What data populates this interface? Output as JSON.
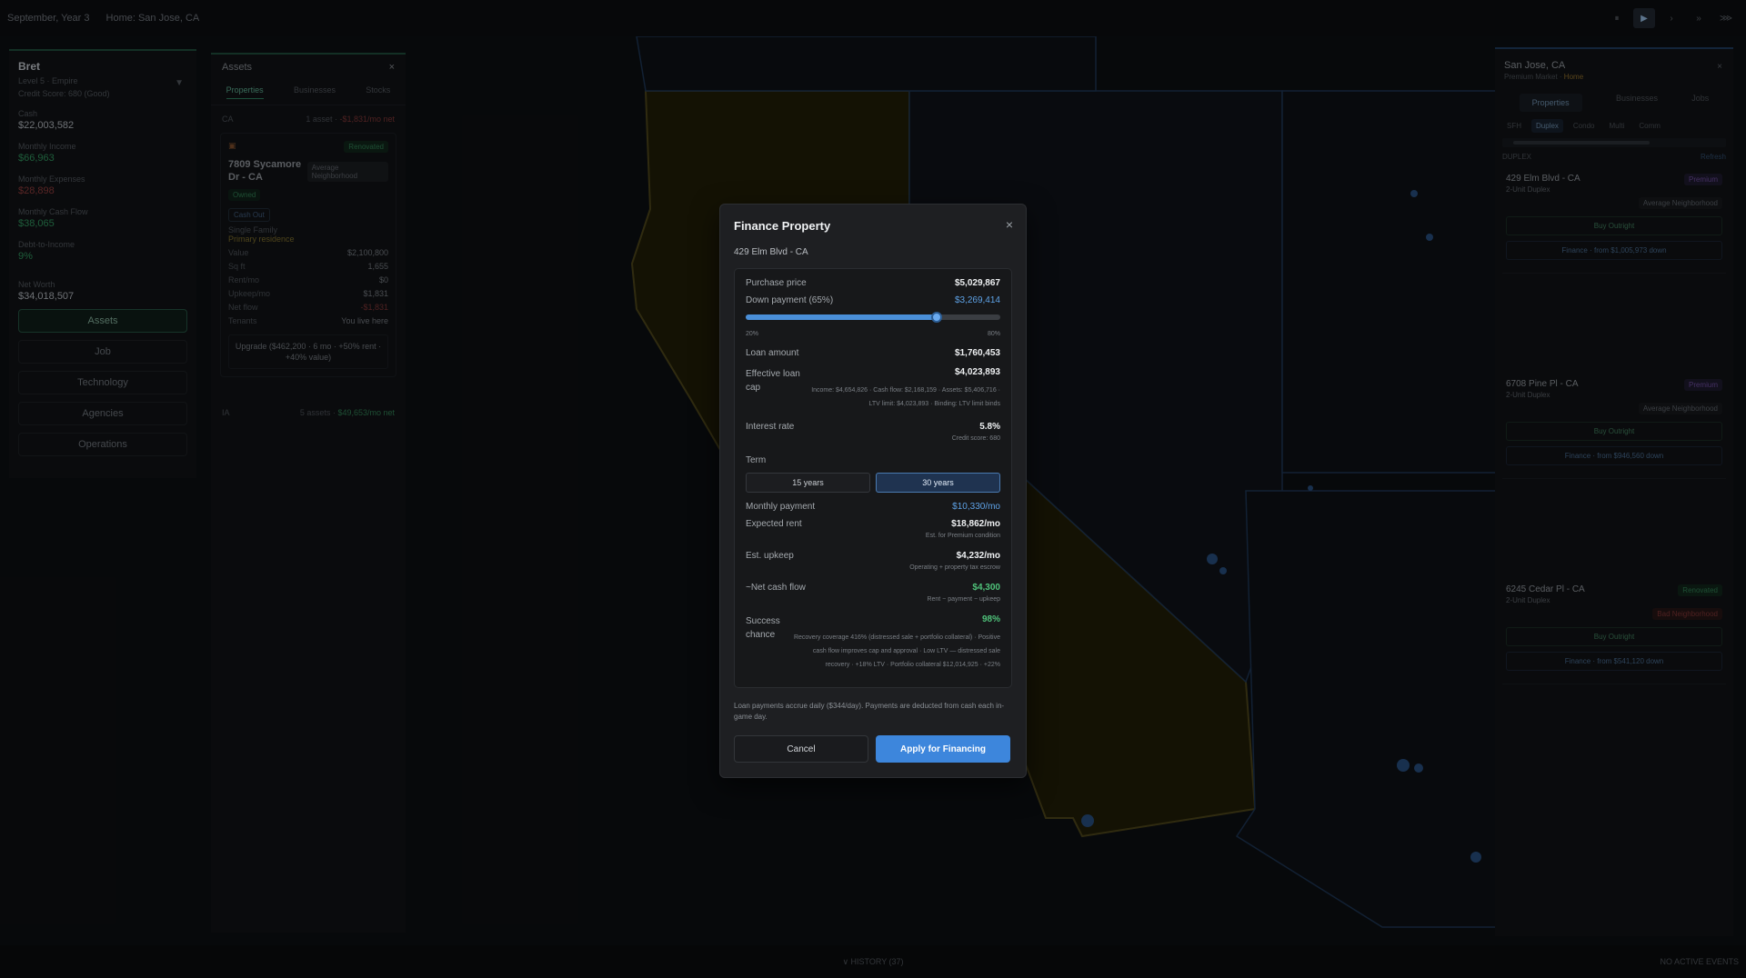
{
  "topbar": {
    "date": "September, Year 3",
    "home": "Home: San Jose, CA",
    "controls": [
      "⏸",
      "▶",
      "›",
      "»",
      "⋙"
    ]
  },
  "player": {
    "name": "Bret",
    "level": "Level 5 · Empire",
    "credit": "Credit Score: 680 (Good)",
    "cash_label": "Cash",
    "cash": "$22,003,582",
    "income_label": "Monthly Income",
    "income": "$66,963",
    "expenses_label": "Monthly Expenses",
    "expenses": "$28,898",
    "cashflow_label": "Monthly Cash Flow",
    "cashflow": "$38,065",
    "dti_label": "Debt-to-Income",
    "dti": "9%",
    "networth_label": "Net Worth",
    "networth": "$34,018,507",
    "nav": [
      "Assets",
      "Job",
      "Technology",
      "Agencies",
      "Operations"
    ]
  },
  "assets": {
    "title": "Assets",
    "close": "×",
    "tabs": [
      "Properties",
      "Businesses",
      "Stocks"
    ],
    "region_ca": {
      "name": "CA",
      "count": "1 asset",
      "net": "-$1,831/mo net"
    },
    "card": {
      "status": "Renovated",
      "title": "7809 Sycamore Dr - CA",
      "neighborhood": "Average Neighborhood",
      "owned": "Owned",
      "cashout": "Cash Out",
      "type": "Single Family",
      "primary": "Primary residence",
      "rows": [
        {
          "k": "Value",
          "v": "$2,100,800"
        },
        {
          "k": "Sq ft",
          "v": "1,655"
        },
        {
          "k": "Rent/mo",
          "v": "$0"
        },
        {
          "k": "Upkeep/mo",
          "v": "$1,831"
        },
        {
          "k": "Net flow",
          "v": "-$1,831"
        },
        {
          "k": "Tenants",
          "v": "You live here"
        }
      ],
      "upgrade": "Upgrade ($462,200 · 6 mo · +50% rent · +40% value)"
    },
    "region_ia": {
      "name": "IA",
      "count": "5 assets",
      "net": "$49,653/mo net"
    }
  },
  "market": {
    "title": "San Jose, CA",
    "sub": "Premium Market",
    "home": "Home",
    "tabs": [
      "Properties",
      "Businesses",
      "Jobs"
    ],
    "chips": [
      "SFH",
      "Duplex",
      "Condo",
      "Multi",
      "Comm"
    ],
    "section": "DUPLEX",
    "refresh": "Refresh",
    "cards": [
      {
        "title": "429 Elm Blvd - CA",
        "type": "2-Unit Duplex",
        "badge": "Premium",
        "hood": "Average Neighborhood",
        "buy": "Buy Outright",
        "finance": "Finance · from $1,005,973 down"
      },
      {
        "title": "6708 Pine Pl - CA",
        "type": "2-Unit Duplex",
        "badge": "Premium",
        "hood": "Average Neighborhood",
        "buy": "Buy Outright",
        "finance": "Finance · from $946,560 down"
      },
      {
        "title": "6245 Cedar Pl - CA",
        "type": "2-Unit Duplex",
        "badge": "Renovated",
        "hood": "Bad Neighborhood",
        "buy": "Buy Outright",
        "finance": "Finance · from $541,120 down"
      }
    ]
  },
  "bottombar": {
    "history": "∨  HISTORY (37)",
    "events": "NO ACTIVE EVENTS"
  },
  "modal": {
    "title": "Finance Property",
    "close": "×",
    "address": "429 Elm Blvd - CA",
    "purchase_label": "Purchase price",
    "purchase": "$5,029,867",
    "down_label": "Down payment (65%)",
    "down": "$3,269,414",
    "slider_value": 0.75,
    "slider_min": "20%",
    "slider_max": "80%",
    "loan_label": "Loan amount",
    "loan": "$1,760,453",
    "cap_label": "Effective loan cap",
    "cap": "$4,023,893",
    "cap_note": "Income: $4,654,826 · Cash flow: $2,168,159 · Assets: $5,406,716 · LTV limit: $4,023,893 · Binding: LTV limit binds",
    "rate_label": "Interest rate",
    "rate": "5.8%",
    "rate_note": "Credit score: 680",
    "term_label": "Term",
    "term_15": "15 years",
    "term_30": "30 years",
    "monthly_label": "Monthly payment",
    "monthly": "$10,330/mo",
    "rent_label": "Expected rent",
    "rent": "$18,862/mo",
    "rent_note": "Est. for Premium condition",
    "upkeep_label": "Est. upkeep",
    "upkeep": "$4,232/mo",
    "upkeep_note": "Operating + property tax escrow",
    "net_label": "~Net cash flow",
    "net": "$4,300",
    "net_note": "Rent − payment − upkeep",
    "success_label": "Success chance",
    "success": "98%",
    "success_note": "Recovery coverage 416% (distressed sale + portfolio collateral) · Positive cash flow improves cap and approval · Low LTV — distressed sale recovery · +18% LTV · Portfolio collateral $12,014,925 · +22%",
    "footer_note": "Loan payments accrue daily ($344/day). Payments are deducted from cash each in-game day.",
    "cancel": "Cancel",
    "apply": "Apply for Financing"
  }
}
